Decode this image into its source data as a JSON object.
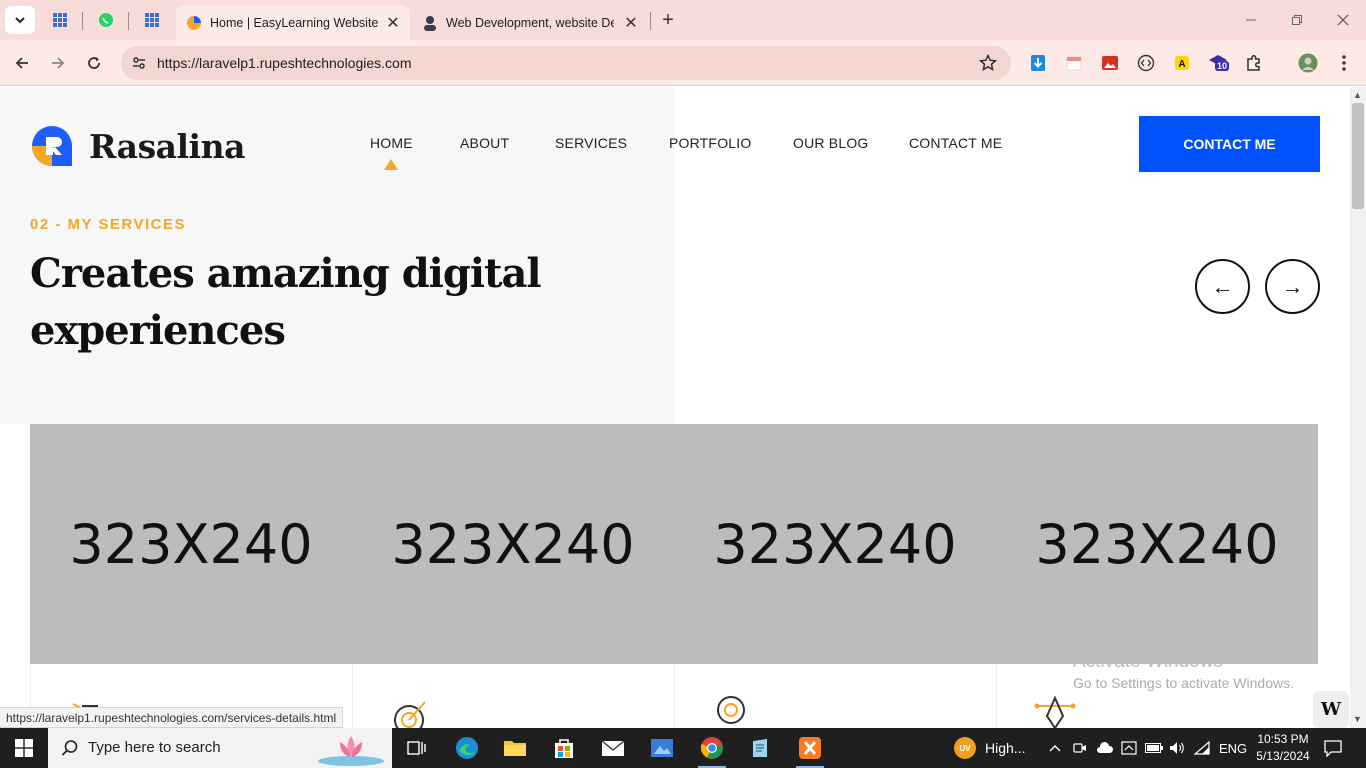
{
  "browser": {
    "tabs": [
      {
        "title": "Home | EasyLearning Website",
        "active": true
      },
      {
        "title": "Web Development, website Des",
        "active": false
      }
    ],
    "new_tab": "+",
    "url": "https://laravelp1.rupeshtechnologies.com",
    "extension_badge": "10",
    "status_url": "https://laravelp1.rupeshtechnologies.com/services-details.html"
  },
  "site": {
    "brand": "Rasalina",
    "nav": [
      "HOME",
      "ABOUT",
      "SERVICES",
      "PORTFOLIO",
      "OUR BLOG",
      "CONTACT ME"
    ],
    "active_nav": "HOME",
    "cta": "CONTACT ME",
    "eyebrow": "02 - MY SERVICES",
    "headline_line1": "Creates amazing digital",
    "headline_line2": "experiences",
    "prev_arrow": "←",
    "next_arrow": "→",
    "placeholders": [
      "323X240",
      "323X240",
      "323X240",
      "323X240"
    ],
    "accent_color": "#f5a623",
    "cta_color": "#0051ff"
  },
  "overlay": {
    "activate_title": "Activate Windows",
    "activate_sub": "Go to Settings to activate Windows.",
    "badge": "W"
  },
  "taskbar": {
    "search_placeholder": "Type here to search",
    "weather": "High...",
    "weather_badge": "UV",
    "language": "ENG",
    "time": "10:53 PM",
    "date": "5/13/2024"
  }
}
